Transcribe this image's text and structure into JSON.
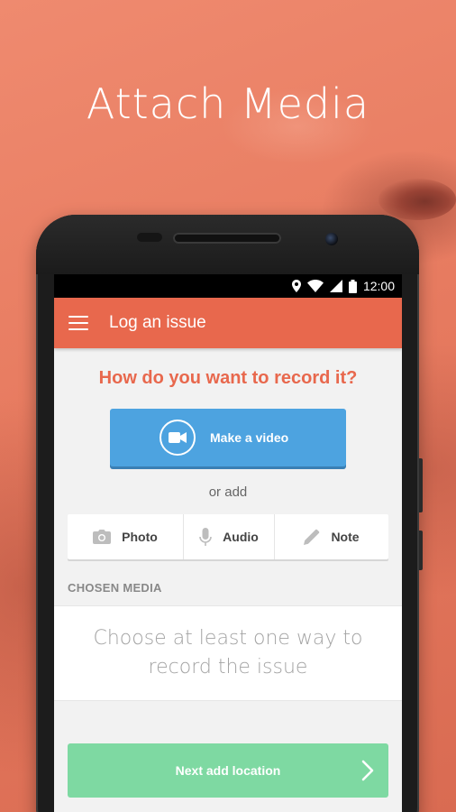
{
  "promo": {
    "headline": "Attach Media"
  },
  "status_bar": {
    "time": "12:00"
  },
  "app_bar": {
    "title": "Log an issue"
  },
  "record": {
    "question": "How do you want to record it?",
    "video_button": "Make a video",
    "or_add": "or add",
    "options": [
      {
        "label": "Photo",
        "icon": "camera-icon"
      },
      {
        "label": "Audio",
        "icon": "microphone-icon"
      },
      {
        "label": "Note",
        "icon": "pencil-icon"
      }
    ]
  },
  "chosen_media": {
    "label": "CHOSEN MEDIA",
    "empty_text": "Choose at least one way to record the issue"
  },
  "next_button": {
    "label": "Next add location"
  },
  "colors": {
    "background": "#e87a5e",
    "app_bar": "#e8684d",
    "accent_text": "#e8684d",
    "video_button": "#4da3e0",
    "next_button": "#7ed9a2"
  }
}
